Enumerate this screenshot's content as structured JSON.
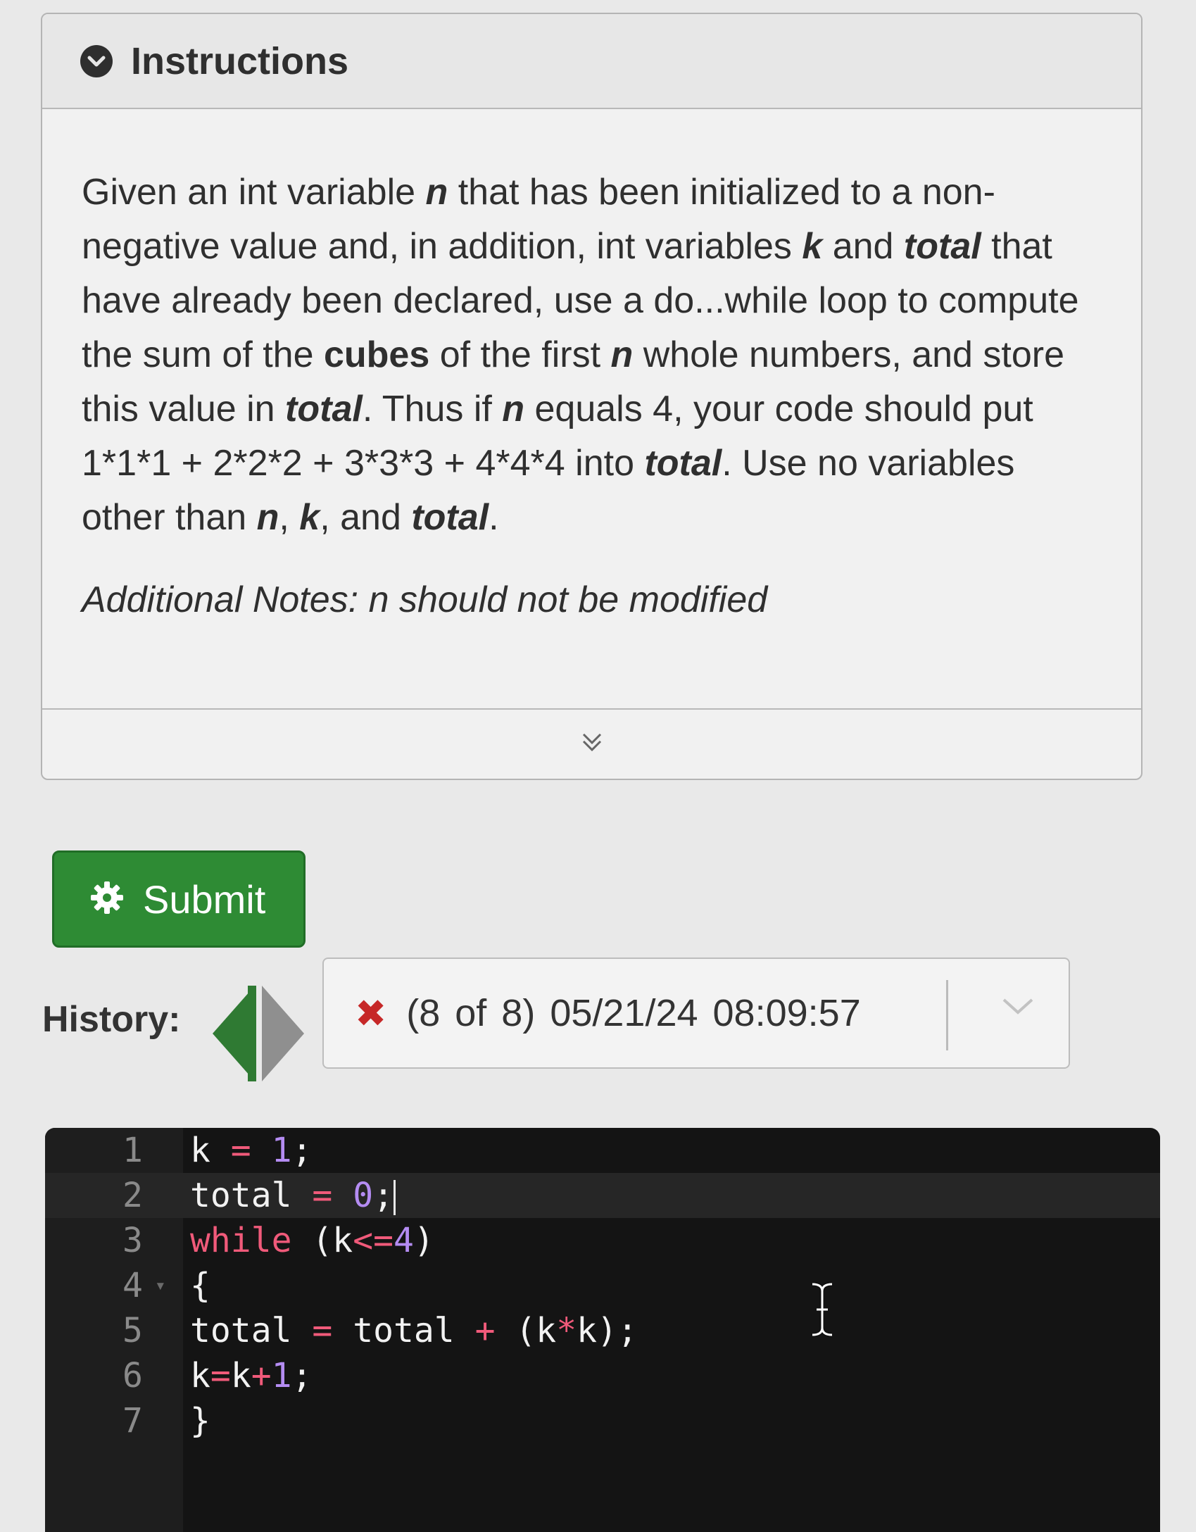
{
  "instructions": {
    "title": "Instructions",
    "paragraph": {
      "p1": "Given an int variable ",
      "n1": "n",
      "p2": " that has been initialized to a non-negative value and, in addition, int variables ",
      "k1": "k",
      "p3": " and ",
      "total1": "total",
      "p4": " that have already been declared, use a do...while loop to compute the sum of the ",
      "cubes": "cubes",
      "p5": " of the first ",
      "n2": "n",
      "p6": " whole numbers, and store this value in ",
      "total2": "total",
      "p7": ". Thus if ",
      "n3": "n",
      "p8": " equals 4, your code should put 1*1*1 + 2*2*2 + 3*3*3 + 4*4*4 into ",
      "total3": "total",
      "p9": ". Use no variables other than ",
      "n4": "n",
      "p10": ", ",
      "k2": "k",
      "p11": ", and ",
      "total4": "total",
      "p12": "."
    },
    "notes": "Additional Notes: n should not be modified"
  },
  "submit": {
    "label": "Submit",
    "icon": "gear-icon"
  },
  "history": {
    "label": "History:",
    "selected": "(8 of 8) 05/21/24  08:09:57",
    "status_icon": "x-icon",
    "status_color": "#c62828"
  },
  "editor": {
    "lines": [
      {
        "num": "1",
        "tokens": [
          {
            "t": "k ",
            "c": ""
          },
          {
            "t": "=",
            "c": "op"
          },
          {
            "t": " ",
            "c": ""
          },
          {
            "t": "1",
            "c": "num"
          },
          {
            "t": ";",
            "c": ""
          }
        ]
      },
      {
        "num": "2",
        "tokens": [
          {
            "t": "total ",
            "c": ""
          },
          {
            "t": "=",
            "c": "op"
          },
          {
            "t": " ",
            "c": ""
          },
          {
            "t": "0",
            "c": "num"
          },
          {
            "t": ";",
            "c": ""
          }
        ]
      },
      {
        "num": "3",
        "tokens": [
          {
            "t": "while",
            "c": "kw"
          },
          {
            "t": " (k",
            "c": ""
          },
          {
            "t": "<=",
            "c": "op"
          },
          {
            "t": "4",
            "c": "num"
          },
          {
            "t": ")",
            "c": ""
          }
        ]
      },
      {
        "num": "4",
        "tokens": [
          {
            "t": "{",
            "c": ""
          }
        ]
      },
      {
        "num": "5",
        "tokens": [
          {
            "t": "total ",
            "c": ""
          },
          {
            "t": "=",
            "c": "op"
          },
          {
            "t": " total ",
            "c": ""
          },
          {
            "t": "+",
            "c": "op"
          },
          {
            "t": " (k",
            "c": ""
          },
          {
            "t": "*",
            "c": "op"
          },
          {
            "t": "k);",
            "c": ""
          }
        ]
      },
      {
        "num": "6",
        "tokens": [
          {
            "t": "k",
            "c": ""
          },
          {
            "t": "=",
            "c": "op"
          },
          {
            "t": "k",
            "c": ""
          },
          {
            "t": "+",
            "c": "op"
          },
          {
            "t": "1",
            "c": "num"
          },
          {
            "t": ";",
            "c": ""
          }
        ]
      },
      {
        "num": "7",
        "tokens": [
          {
            "t": "}",
            "c": ""
          }
        ]
      }
    ]
  },
  "colors": {
    "submit_green": "#2e8b34",
    "history_prev_arrow": "#2f7a33",
    "history_next_arrow": "#8f8f8f",
    "editor_bg": "#141414"
  }
}
